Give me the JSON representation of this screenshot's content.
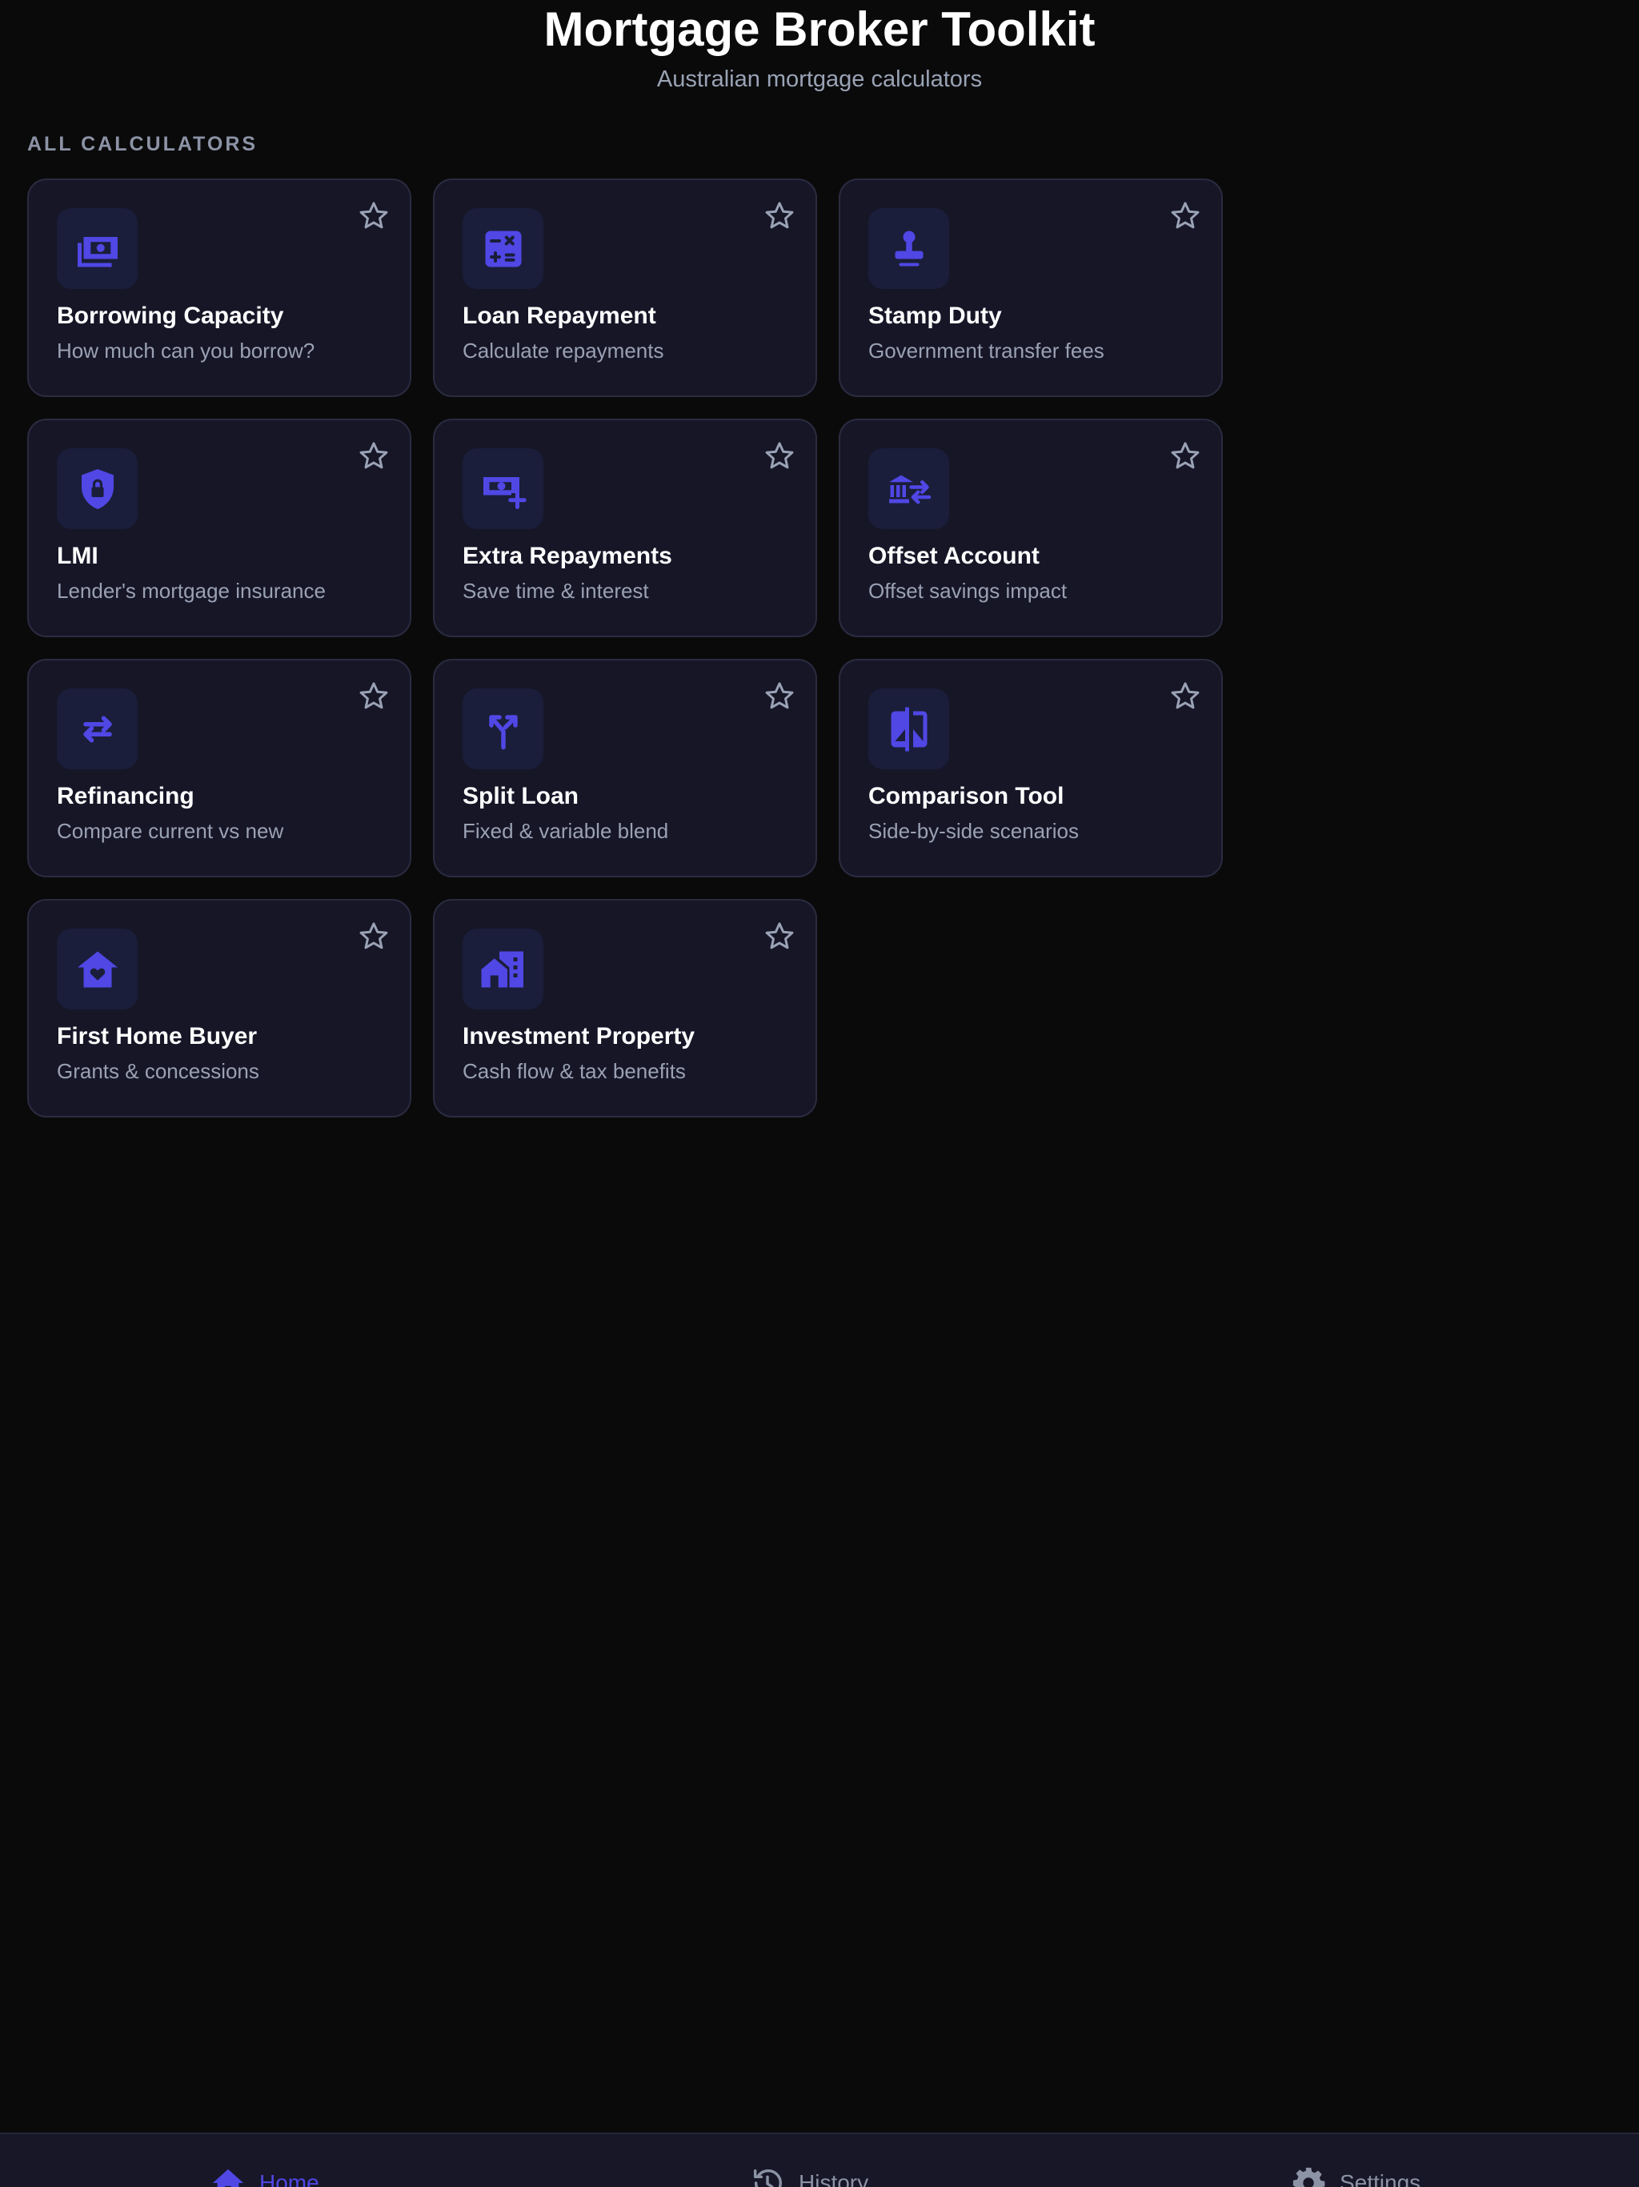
{
  "header": {
    "title": "Mortgage Broker Toolkit",
    "subtitle": "Australian mortgage calculators"
  },
  "section": {
    "label": "ALL CALCULATORS"
  },
  "calculators": [
    {
      "title": "Borrowing Capacity",
      "description": "How much can you borrow?",
      "icon": "money-stack-icon",
      "favorited": false
    },
    {
      "title": "Loan Repayment",
      "description": "Calculate repayments",
      "icon": "calculator-icon",
      "favorited": false
    },
    {
      "title": "Stamp Duty",
      "description": "Government transfer fees",
      "icon": "stamp-icon",
      "favorited": false
    },
    {
      "title": "LMI",
      "description": "Lender's mortgage insurance",
      "icon": "shield-lock-icon",
      "favorited": false
    },
    {
      "title": "Extra Repayments",
      "description": "Save time & interest",
      "icon": "money-plus-icon",
      "favorited": false
    },
    {
      "title": "Offset Account",
      "description": "Offset savings impact",
      "icon": "bank-transfer-icon",
      "favorited": false
    },
    {
      "title": "Refinancing",
      "description": "Compare current vs new",
      "icon": "swap-arrows-icon",
      "favorited": false
    },
    {
      "title": "Split Loan",
      "description": "Fixed & variable blend",
      "icon": "split-arrows-icon",
      "favorited": false
    },
    {
      "title": "Comparison Tool",
      "description": "Side-by-side scenarios",
      "icon": "compare-icon",
      "favorited": false
    },
    {
      "title": "First Home Buyer",
      "description": "Grants & concessions",
      "icon": "home-heart-icon",
      "favorited": false
    },
    {
      "title": "Investment Property",
      "description": "Cash flow & tax benefits",
      "icon": "city-buildings-icon",
      "favorited": false
    }
  ],
  "nav": {
    "items": [
      {
        "label": "Home",
        "icon": "home-icon",
        "active": true
      },
      {
        "label": "History",
        "icon": "history-icon",
        "active": false
      },
      {
        "label": "Settings",
        "icon": "gear-icon",
        "active": false
      }
    ]
  },
  "colors": {
    "background": "#0a0a0b",
    "card": "#161627",
    "accent": "#5047e5",
    "muted": "#9aa1b3"
  }
}
